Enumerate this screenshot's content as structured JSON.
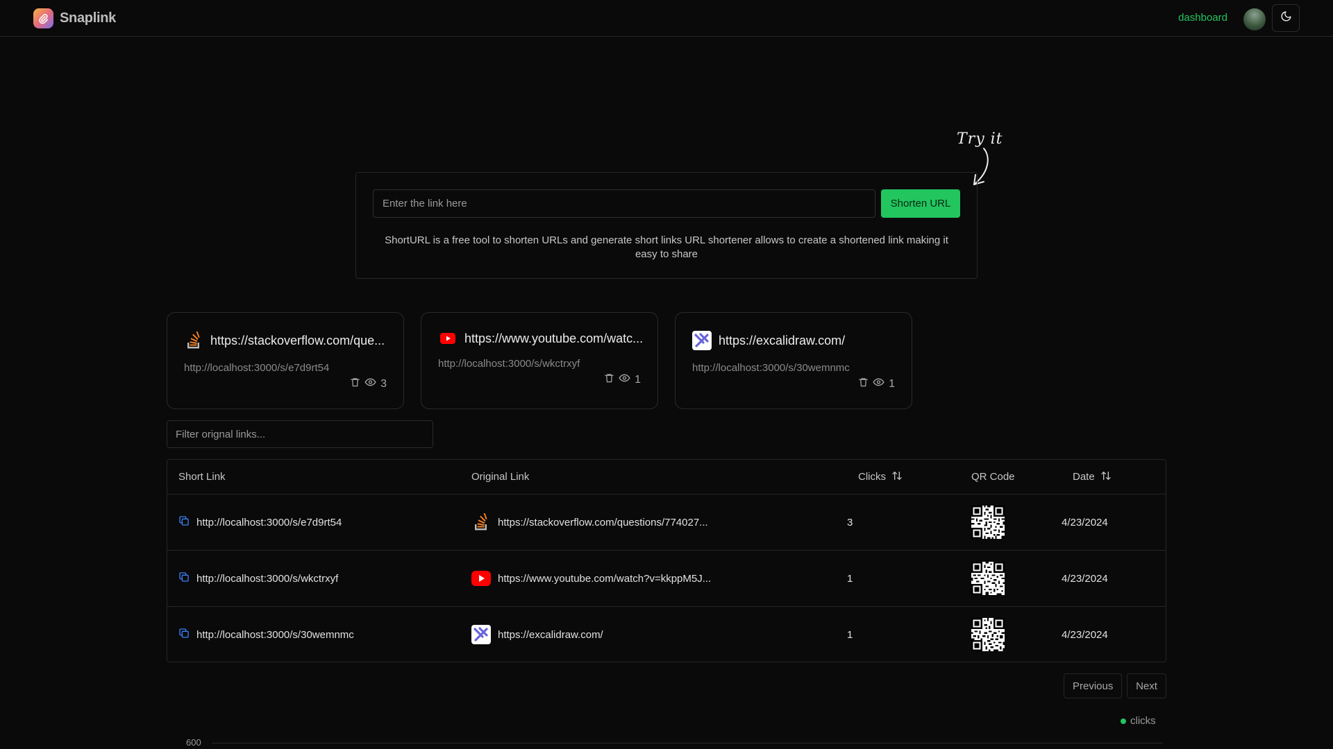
{
  "header": {
    "brand": "Snaplink",
    "nav_dashboard": "dashboard",
    "theme_icon": "moon-icon"
  },
  "hero": {
    "tryit": "Try it",
    "input_placeholder": "Enter the link here",
    "input_value": "",
    "shorten_label": "Shorten URL",
    "description": "ShortURL is a free tool to shorten URLs and generate short links URL shortener allows to create a shortened link making it easy to share"
  },
  "cards": [
    {
      "icon": "stackoverflow-icon",
      "original": "https://stackoverflow.com/que...",
      "short": "http://localhost:3000/s/e7d9rt54",
      "clicks": "3"
    },
    {
      "icon": "youtube-icon",
      "original": "https://www.youtube.com/watc...",
      "short": "http://localhost:3000/s/wkctrxyf",
      "clicks": "1"
    },
    {
      "icon": "excalidraw-icon",
      "original": "https://excalidraw.com/",
      "short": "http://localhost:3000/s/30wemnmc",
      "clicks": "1"
    }
  ],
  "filter": {
    "placeholder": "Filter orignal links...",
    "value": ""
  },
  "table": {
    "headers": {
      "short": "Short Link",
      "original": "Original Link",
      "clicks": "Clicks",
      "qr": "QR Code",
      "date": "Date"
    },
    "rows": [
      {
        "short": "http://localhost:3000/s/e7d9rt54",
        "icon": "stackoverflow-icon",
        "original": "https://stackoverflow.com/questions/774027...",
        "clicks": "3",
        "date": "4/23/2024"
      },
      {
        "short": "http://localhost:3000/s/wkctrxyf",
        "icon": "youtube-icon",
        "original": "https://www.youtube.com/watch?v=kkppM5J...",
        "clicks": "1",
        "date": "4/23/2024"
      },
      {
        "short": "http://localhost:3000/s/30wemnmc",
        "icon": "excalidraw-icon",
        "original": "https://excalidraw.com/",
        "clicks": "1",
        "date": "4/23/2024"
      }
    ]
  },
  "pagination": {
    "previous": "Previous",
    "next": "Next"
  },
  "chart": {
    "legend": "clicks",
    "y_top_tick": "600"
  },
  "colors": {
    "accent": "#22c55e",
    "background": "#0a0a0a",
    "border": "#262626"
  }
}
